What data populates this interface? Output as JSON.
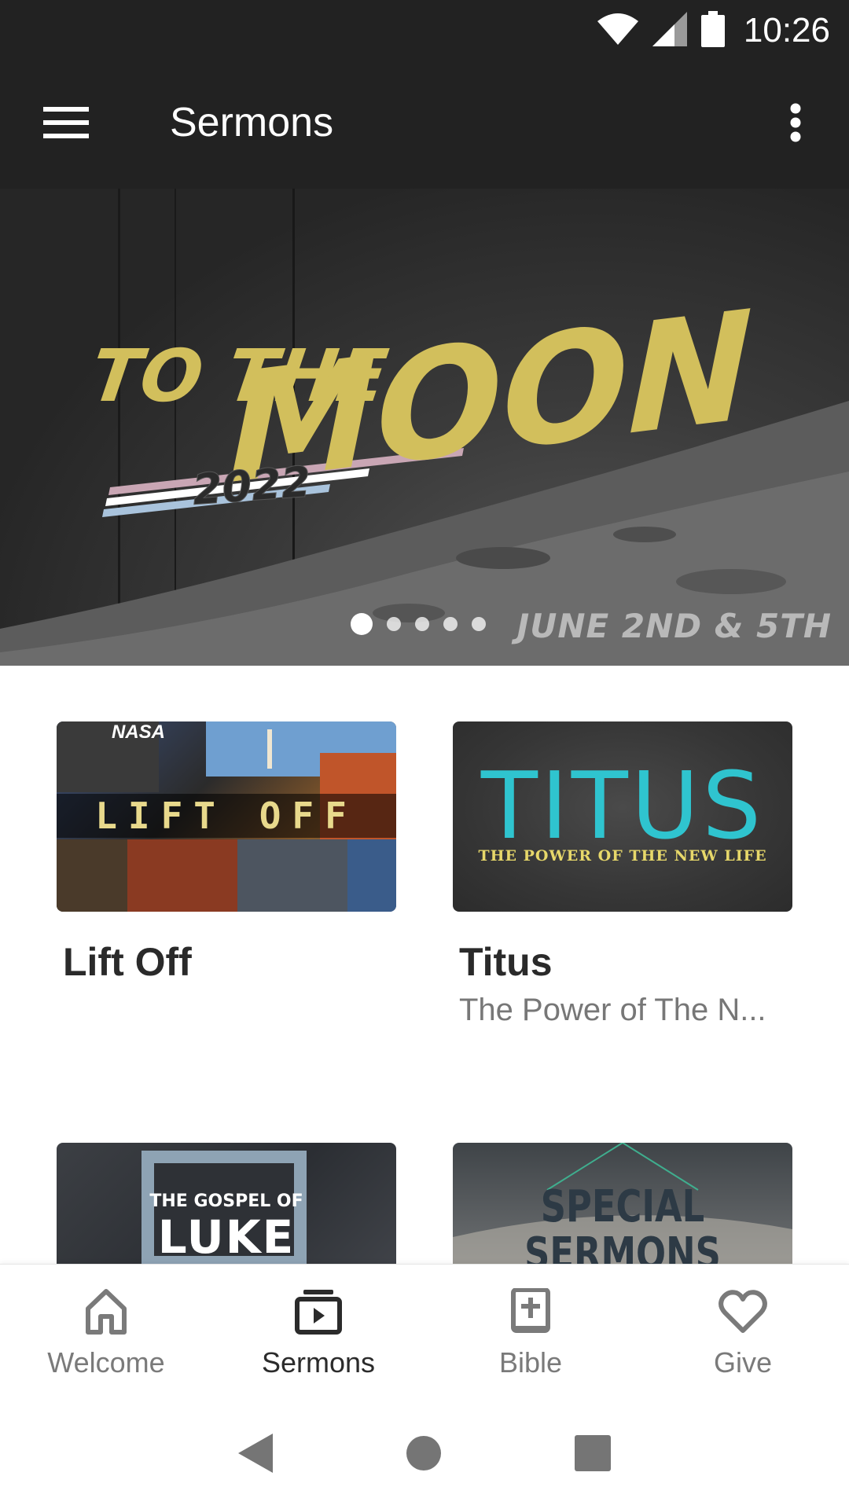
{
  "status_bar": {
    "time": "10:26",
    "icons": [
      "wifi-icon",
      "signal-icon",
      "battery-icon"
    ]
  },
  "app_bar": {
    "title": "Sermons",
    "menu_icon": "hamburger-menu-icon",
    "overflow_icon": "more-vert-icon"
  },
  "hero": {
    "title_small": "TO THE",
    "title_large": "MOON",
    "year": "2022",
    "date": "JUNE 2ND & 5TH",
    "slide_count": 5,
    "active_slide": 1
  },
  "series": [
    {
      "title": "Lift Off",
      "subtitle": "",
      "art_text": "LIFT OFF",
      "art_brand": "NASA"
    },
    {
      "title": "Titus",
      "subtitle": "The Power of The N...",
      "art_text": "TITUS",
      "art_subtext": "THE POWER OF THE NEW LIFE"
    },
    {
      "title": "",
      "subtitle": "",
      "art_text_1": "THE GOSPEL OF",
      "art_text_2": "LUKE"
    },
    {
      "title": "",
      "subtitle": "",
      "art_text": "SPECIAL SERMONS"
    }
  ],
  "bottom_nav": {
    "items": [
      {
        "label": "Welcome",
        "icon": "home-icon",
        "active": false
      },
      {
        "label": "Sermons",
        "icon": "video-library-icon",
        "active": true
      },
      {
        "label": "Bible",
        "icon": "bible-icon",
        "active": false
      },
      {
        "label": "Give",
        "icon": "heart-icon",
        "active": false
      }
    ]
  },
  "colors": {
    "app_bar": "#222222",
    "accent_gold": "#d2bf5c",
    "titus_teal": "#2fc4cf",
    "nav_active": "#2b2b2b",
    "nav_inactive": "#7a7a7a"
  }
}
